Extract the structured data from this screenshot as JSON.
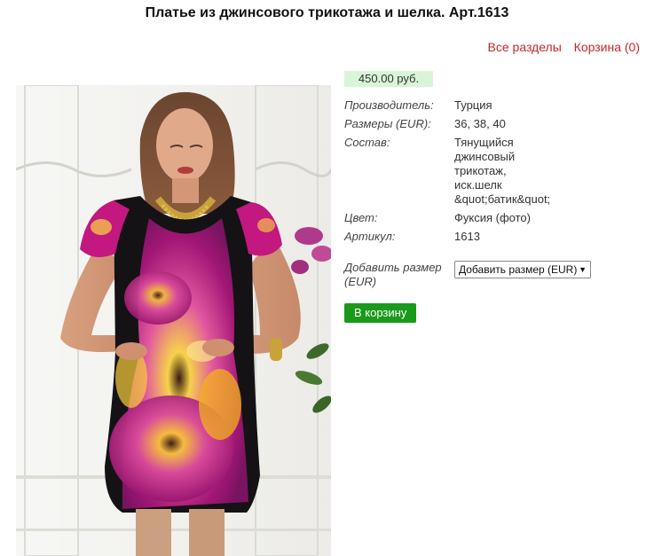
{
  "page": {
    "title": "Платье из джинсового трикотажа и шелка. Арт.1613"
  },
  "nav": {
    "all_sections": "Все разделы",
    "cart": "Корзина (0)"
  },
  "product": {
    "price": "450.00 руб.",
    "specs": [
      {
        "key": "Производитель:",
        "value": "Турция"
      },
      {
        "key": "Размеры (EUR):",
        "value": "36, 38, 40"
      },
      {
        "key": "Состав:",
        "value": "Тянущийся джинсовый трикотаж, иск.шелк &quot;батик&quot;"
      },
      {
        "key": "Цвет:",
        "value": "Фуксия (фото)"
      },
      {
        "key": "Артикул:",
        "value": "1613"
      }
    ],
    "size_label": "Добавить размер (EUR)",
    "size_select": "Добавить размер (EUR)",
    "add_to_cart": "В корзину"
  },
  "colors": {
    "link": "#c62828",
    "price_bg": "#d8f5d8",
    "button": "#1a9a1a",
    "dress_primary": "#c2187f",
    "dress_secondary": "#f2b21c"
  }
}
